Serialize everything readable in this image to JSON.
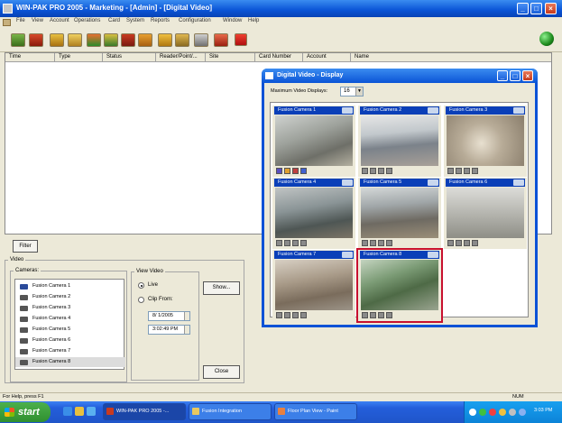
{
  "app": {
    "title": "WIN-PAK PRO 2005 - Marketing - [Admin] - [Digital Video]",
    "menu": [
      "File",
      "View",
      "Account",
      "Operations",
      "Card",
      "System",
      "Reports",
      "Configuration",
      "Window",
      "Help"
    ]
  },
  "toolbar": {
    "icons": [
      "card-icon",
      "building-icon",
      "device-icon",
      "edit-icon",
      "map-icon",
      "alarm-icon",
      "floor-plan-icon",
      "key-icon",
      "folder-icon",
      "report-icon",
      "network-icon",
      "stop-icon"
    ]
  },
  "grid": {
    "columns": [
      "Time",
      "Type",
      "Status",
      "Reader/Point/...",
      "Site",
      "Card Number",
      "Account",
      "Name"
    ]
  },
  "filter_label": "Filter",
  "video": {
    "group_label": "Video",
    "cameras_label": "Cameras:",
    "cameras": [
      "Fusion Camera 1",
      "Fusion Camera 2",
      "Fusion Camera 3",
      "Fusion Camera 4",
      "Fusion Camera 5",
      "Fusion Camera 6",
      "Fusion Camera 7",
      "Fusion Camera 8"
    ],
    "selected_camera": "Fusion Camera 8",
    "view_video_label": "View Video",
    "live_label": "Live",
    "clip_label": "Clip From:",
    "date_value": "8/ 1/2005",
    "time_value": "3:02:49 PM",
    "show_label": "Show...",
    "close_label": "Close"
  },
  "dv_window": {
    "title": "Digital Video - Display",
    "max_label": "Maximum Video Displays:",
    "max_value": "16",
    "cameras": [
      "Fusion Camera 1",
      "Fusion Camera 2",
      "Fusion Camera 3",
      "Fusion Camera 4",
      "Fusion Camera 5",
      "Fusion Camera 6",
      "Fusion Camera 7",
      "Fusion Camera 8"
    ],
    "highlighted": "Fusion Camera 8"
  },
  "status": {
    "help": "For Help, press F1",
    "num": "NUM"
  },
  "taskbar": {
    "start": "start",
    "tasks": [
      "WIN-PAK PRO 2005 -...",
      "Fusion Integration",
      "Floor Plan View - Paint"
    ],
    "clock": "3:03 PM"
  },
  "colors": {
    "title_blue": "#0a54d6",
    "cam_bar": "#0a3fb8",
    "highlight": "#c8102e",
    "taskbar": "#245edb",
    "start_green": "#2f8f2f"
  }
}
